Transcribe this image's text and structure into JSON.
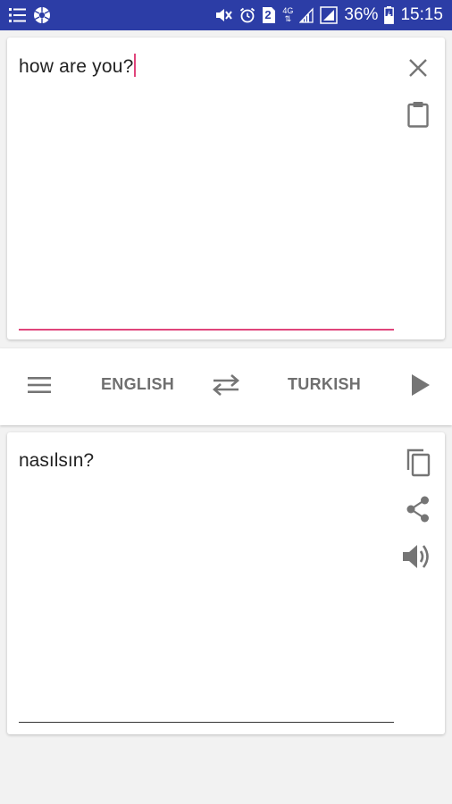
{
  "status_bar": {
    "sim_slot": "2",
    "network": "4G",
    "battery_percent": "36%",
    "time": "15:15",
    "icons": [
      "list-icon",
      "aperture-icon",
      "mute-icon",
      "alarm-icon",
      "sim-icon",
      "network-icon",
      "signal-icon",
      "signal2-icon",
      "battery-icon"
    ]
  },
  "input": {
    "text": "how are you?",
    "accent_color": "#e0457b",
    "icons": [
      "close-icon",
      "clipboard-icon"
    ]
  },
  "toolbar": {
    "source_language": "ENGLISH",
    "target_language": "TURKISH",
    "icons": [
      "menu-icon",
      "swap-icon",
      "play-icon"
    ]
  },
  "output": {
    "text": "nasılsın?",
    "icons": [
      "copy-icon",
      "share-icon",
      "volume-icon"
    ]
  },
  "colors": {
    "status_bar": "#2c3da6",
    "background": "#f2f2f2",
    "icon_gray": "#757575"
  }
}
